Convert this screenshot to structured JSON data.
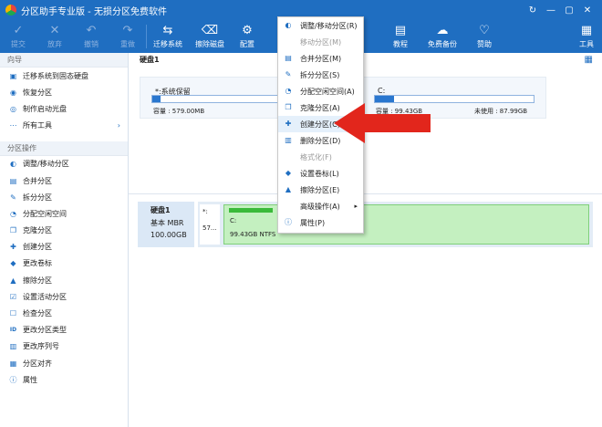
{
  "window": {
    "title": "分区助手专业版 - 无损分区免费软件",
    "controls": [
      "↻",
      "—",
      "▢",
      "✕"
    ]
  },
  "toolbar": {
    "items": [
      {
        "label": "提交",
        "icon": "✓",
        "disabled": true
      },
      {
        "label": "放弃",
        "icon": "✕",
        "disabled": true
      },
      {
        "label": "撤销",
        "icon": "↶",
        "disabled": true
      },
      {
        "label": "重做",
        "icon": "↷",
        "disabled": true
      },
      {
        "label": "迁移系统",
        "icon": "⇆",
        "disabled": false
      },
      {
        "label": "擦除磁盘",
        "icon": "⌫",
        "disabled": false
      },
      {
        "label": "配置",
        "icon": "⚙",
        "disabled": false
      }
    ],
    "right_items": [
      {
        "label": "教程",
        "icon": "▤"
      },
      {
        "label": "免费备份",
        "icon": "☁"
      },
      {
        "label": "赞助",
        "icon": "♡"
      }
    ],
    "tools": {
      "label": "工具",
      "icon": "▦"
    }
  },
  "sidebar": {
    "wizard_title": "向导",
    "wizard_items": [
      {
        "label": "迁移系统到固态硬盘",
        "icon": "▣"
      },
      {
        "label": "恢复分区",
        "icon": "◉"
      },
      {
        "label": "制作启动光盘",
        "icon": "◎"
      },
      {
        "label": "所有工具",
        "icon": "⋯",
        "arrow": "›"
      }
    ],
    "ops_title": "分区操作",
    "ops_items": [
      {
        "label": "调整/移动分区",
        "icon": "◐"
      },
      {
        "label": "合并分区",
        "icon": "▤"
      },
      {
        "label": "拆分分区",
        "icon": "✎"
      },
      {
        "label": "分配空闲空间",
        "icon": "◔"
      },
      {
        "label": "克隆分区",
        "icon": "❐"
      },
      {
        "label": "创建分区",
        "icon": "✚"
      },
      {
        "label": "更改卷标",
        "icon": "◆"
      },
      {
        "label": "擦除分区",
        "icon": "▲"
      },
      {
        "label": "设置活动分区",
        "icon": "☑"
      },
      {
        "label": "检查分区",
        "icon": "☐"
      },
      {
        "label": "更改分区类型",
        "icon": "ID"
      },
      {
        "label": "更改序列号",
        "icon": "▥"
      },
      {
        "label": "分区对齐",
        "icon": "▦"
      },
      {
        "label": "属性",
        "icon": "ⓘ"
      }
    ]
  },
  "main": {
    "disk1_label": "硬盘1",
    "partitions": [
      {
        "name": "*:系统保留",
        "capacity": "容量 : 579.00MB",
        "free": "",
        "fill_percent": 6
      },
      {
        "name": "C:",
        "capacity": "容量 : 99.43GB",
        "free": "未使用 : 87.99GB",
        "fill_percent": 12
      }
    ],
    "disk_map": {
      "name": "硬盘1",
      "type": "基本 MBR",
      "size": "100.00GB",
      "mini_part_label": "*:",
      "mini_part_size": "57...",
      "c_label": "C:",
      "c_info": "99.43GB NTFS",
      "c_fill_percent": 12
    }
  },
  "context_menu": {
    "items": [
      {
        "label": "调整/移动分区(R)",
        "icon": "◐",
        "disabled": false
      },
      {
        "label": "移动分区(M)",
        "icon": "",
        "disabled": true
      },
      {
        "label": "合并分区(M)",
        "icon": "▤",
        "disabled": false
      },
      {
        "label": "拆分分区(S)",
        "icon": "✎",
        "disabled": false
      },
      {
        "label": "分配空闲空间(A)",
        "icon": "◔",
        "disabled": false
      },
      {
        "label": "克隆分区(A)",
        "icon": "❐",
        "disabled": false
      },
      {
        "label": "创建分区(C)",
        "icon": "✚",
        "disabled": false,
        "highlight": true
      },
      {
        "label": "删除分区(D)",
        "icon": "▥",
        "disabled": false
      },
      {
        "label": "格式化(F)",
        "icon": "",
        "disabled": true
      },
      {
        "label": "设置卷标(L)",
        "icon": "◆",
        "disabled": false
      },
      {
        "label": "擦除分区(E)",
        "icon": "▲",
        "disabled": false
      },
      {
        "label": "高级操作(A)",
        "icon": "",
        "disabled": false,
        "submenu": "▸"
      },
      {
        "label": "属性(P)",
        "icon": "ⓘ",
        "disabled": false
      }
    ]
  },
  "colors": {
    "primary": "#1f6ec1",
    "annotation": "#e2261c",
    "partition_green": "#c4f0c0"
  }
}
